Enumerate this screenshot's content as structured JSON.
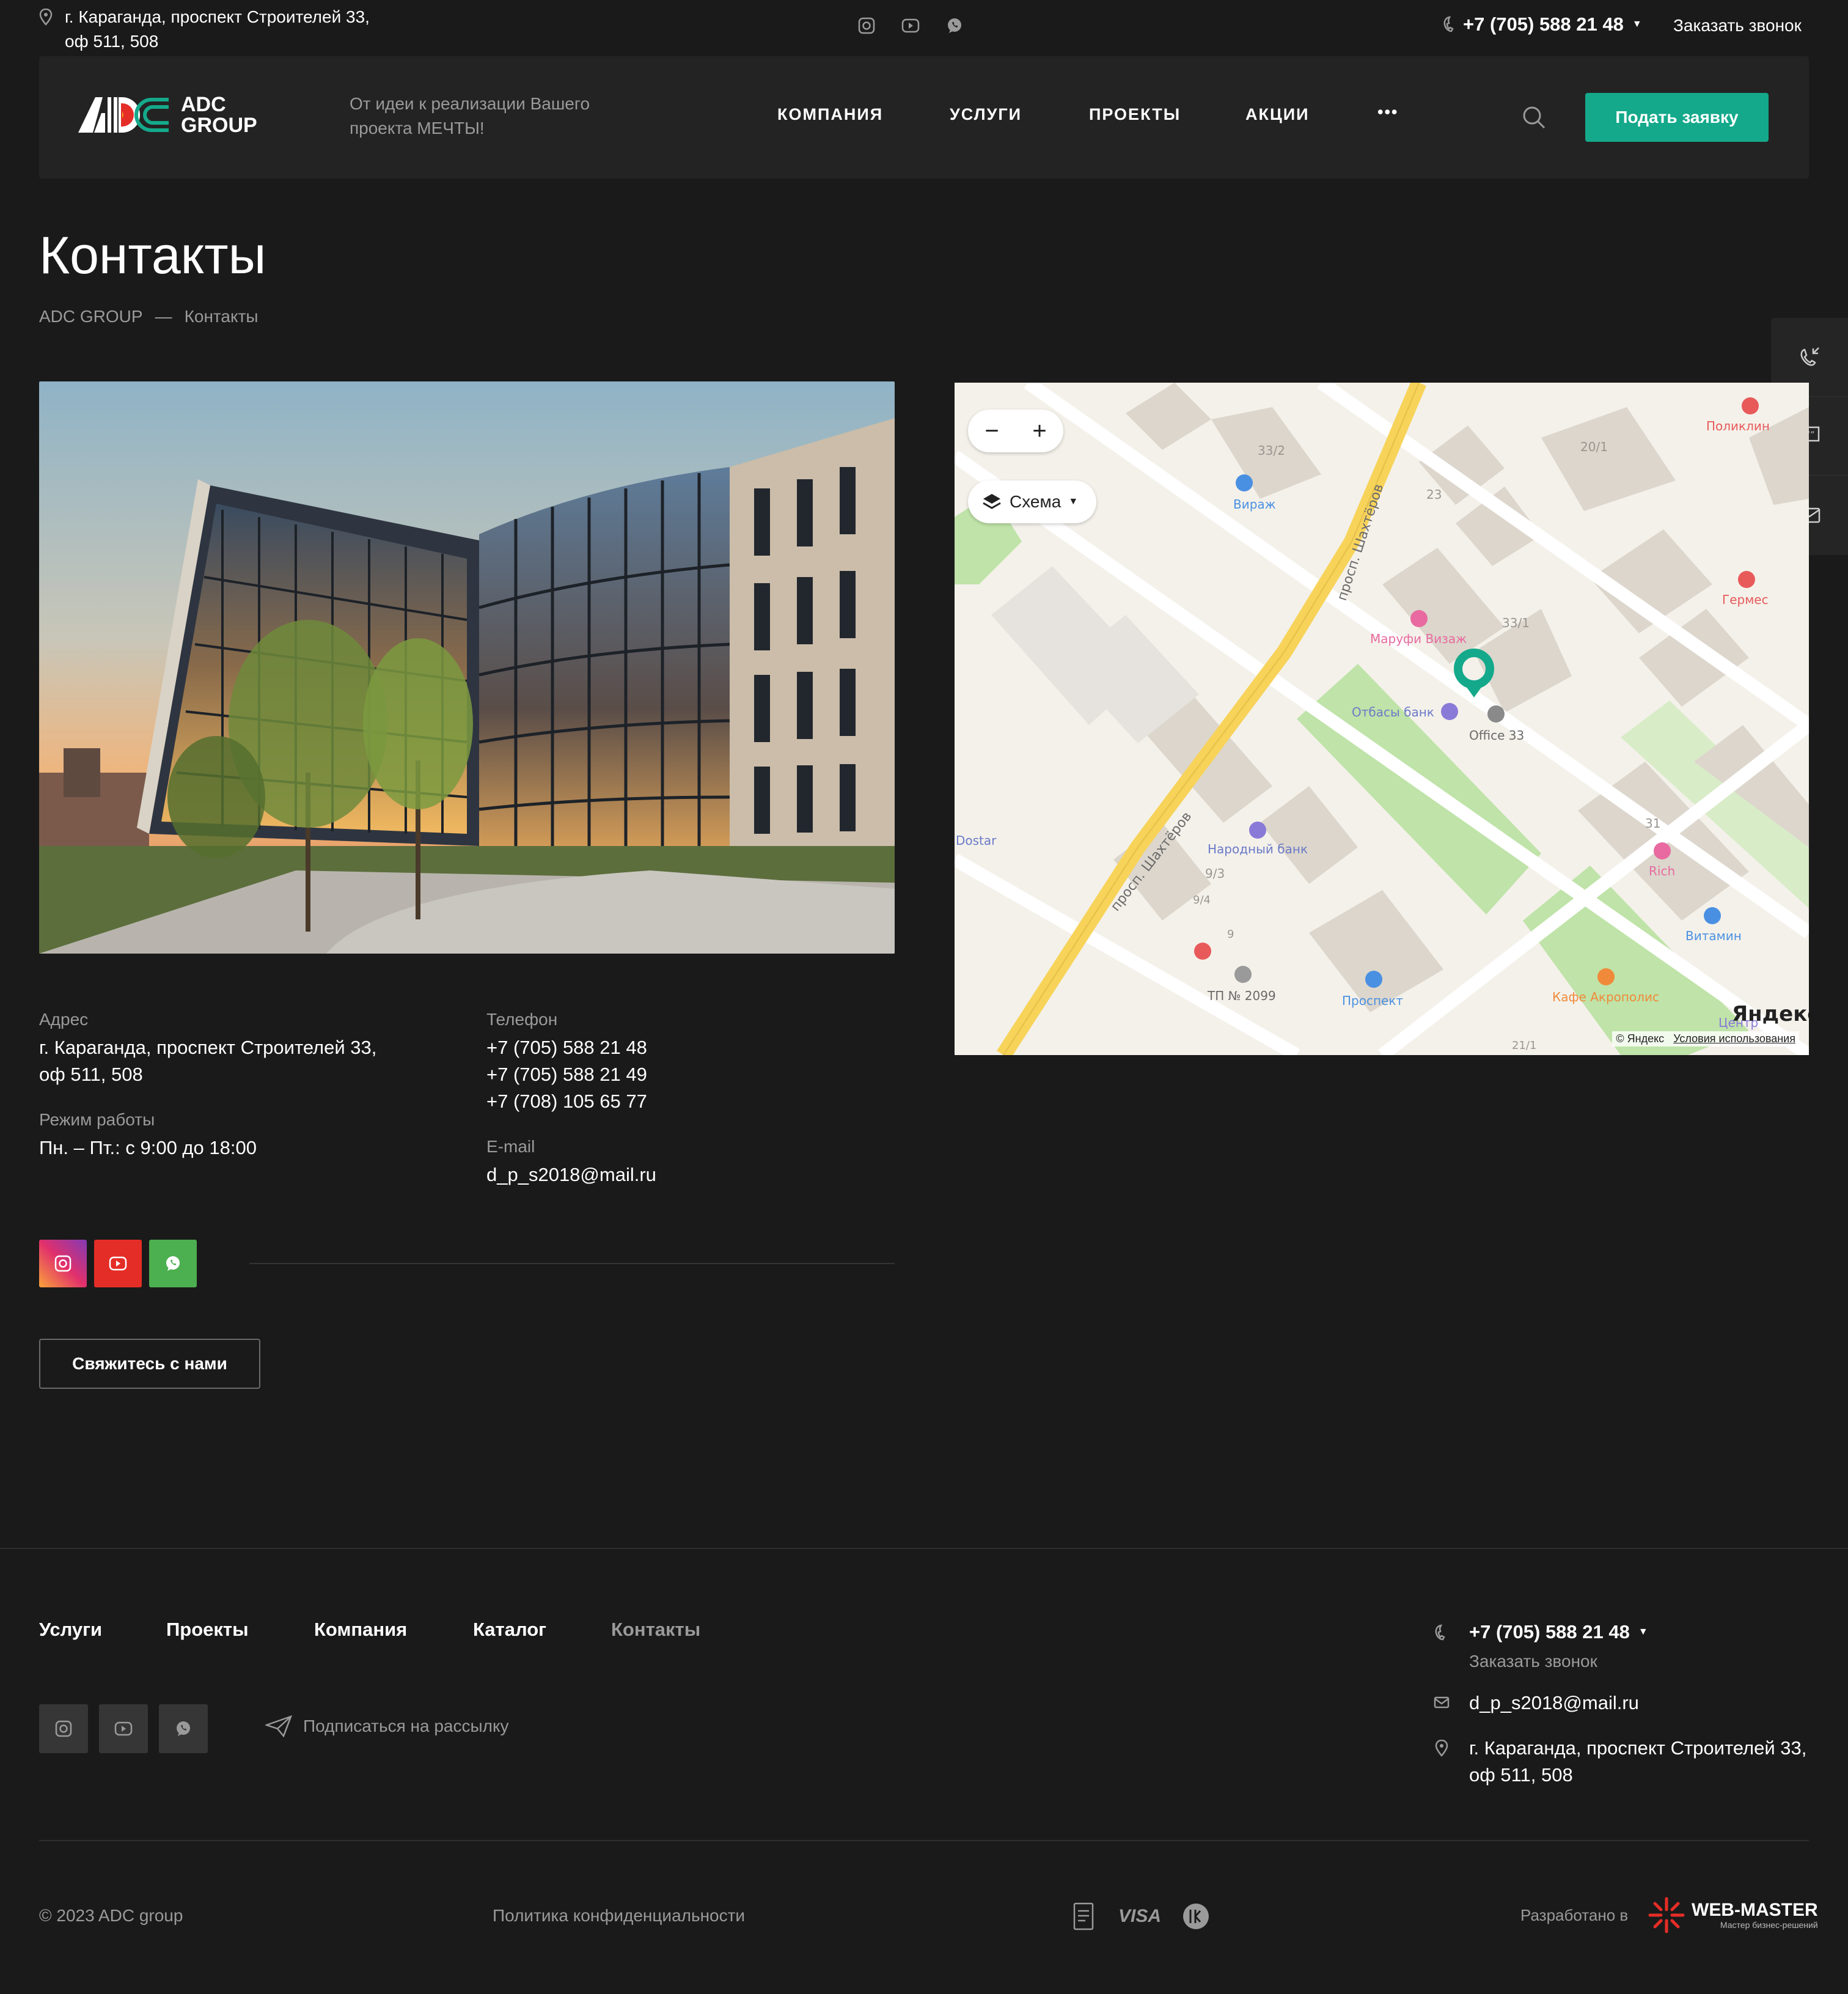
{
  "topbar": {
    "address_line1": "г. Караганда, проспект Строителей 33,",
    "address_line2": "оф 511, 508",
    "phone": "+7 (705) 588 21 48",
    "callback": "Заказать звонок"
  },
  "header": {
    "logo_line1": "ADC",
    "logo_line2": "GROUP",
    "tagline_line1": "От идеи к реализации Вашего",
    "tagline_line2": "проекта МЕЧТЫ!",
    "nav": [
      "КОМПАНИЯ",
      "УСЛУГИ",
      "ПРОЕКТЫ",
      "АКЦИИ"
    ],
    "more": "•••",
    "cta": "Подать заявку"
  },
  "page": {
    "title": "Контакты",
    "breadcrumb": [
      "ADC GROUP",
      "—",
      "Контакты"
    ]
  },
  "map": {
    "layer_label": "Схема",
    "zoom_out": "−",
    "zoom_in": "+",
    "attribution": "© Яндекс",
    "terms": "Условия использования",
    "brand": "Яндекс",
    "labels": {
      "virazh": "Вираж",
      "b33_2": "33/2",
      "b20_1": "20/1",
      "poliklin": "Поликлин",
      "germes": "Гермес",
      "marufi": "Маруфи Визаж",
      "b33_1": "33/1",
      "b23": "23",
      "otbasy": "Отбасы банк",
      "office33": "Office 33",
      "street1": "просп. Шахтёров",
      "street2": "просп. Шахтёров",
      "dostar": "Dostar",
      "narodny": "Народный банк",
      "b9_3": "9/3",
      "b9_4": "9/4",
      "b9": "9",
      "b31": "31",
      "rich": "Rich",
      "vitamin": "Витамин",
      "tp": "ТП № 2099",
      "prospekt": "Проспект",
      "akropolis": "Кафе Акрополис",
      "center": "Центр",
      "b21_1": "21/1"
    }
  },
  "contacts": {
    "address_label": "Адрес",
    "address_line1": "г. Караганда, проспект Строителей 33,",
    "address_line2": "оф 511, 508",
    "hours_label": "Режим работы",
    "hours": "Пн. – Пт.: с 9:00 до 18:00",
    "phone_label": "Телефон",
    "phones": [
      "+7 (705) 588 21 48",
      "+7 (705) 588 21 49",
      "+7 (708) 105 65 77"
    ],
    "email_label": "E-mail",
    "email": "d_p_s2018@mail.ru",
    "contact_button": "Свяжитесь с нами"
  },
  "footer": {
    "nav": [
      "Услуги",
      "Проекты",
      "Компания",
      "Каталог",
      "Контакты"
    ],
    "subscribe": "Подписаться на рассылку",
    "phone": "+7 (705) 588 21 48",
    "callback": "Заказать звонок",
    "email": "d_p_s2018@mail.ru",
    "address_line1": "г. Караганда, проспект Строителей 33,",
    "address_line2": "оф 511, 508",
    "copyright": "© 2023 ADC group",
    "privacy": "Политика конфиденциальности",
    "visa": "VISA",
    "developed_by": "Разработано в",
    "dev_brand": "WEB-MASTER",
    "dev_tagline": "Мастер бизнес-решений"
  },
  "colors": {
    "background": "#1a1a1a",
    "header_bg": "#232323",
    "accent": "#14a98b",
    "youtube": "#e52d27",
    "whatsapp": "#4caf50"
  },
  "icons": [
    "location-pin-icon",
    "instagram-icon",
    "youtube-icon",
    "whatsapp-icon",
    "phone-icon",
    "search-icon",
    "callback-icon",
    "chat-icon",
    "mail-icon",
    "send-icon",
    "layers-icon",
    "map-marker-icon"
  ]
}
